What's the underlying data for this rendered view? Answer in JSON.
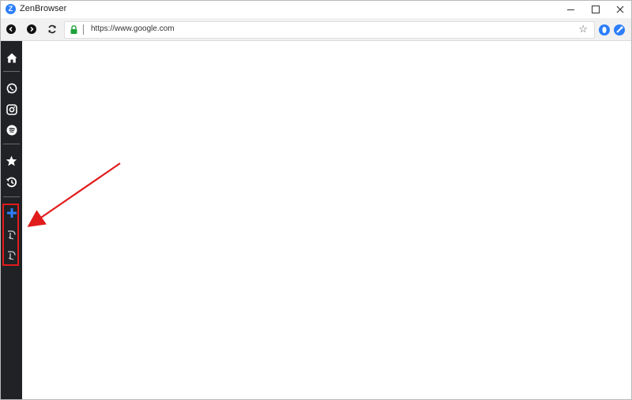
{
  "window": {
    "title": "ZenBrowser",
    "logo_letter": "Z",
    "controls": [
      "minimize-icon",
      "maximize-icon",
      "close-icon"
    ]
  },
  "toolbar": {
    "back_icon": "chevron-left-icon",
    "forward_icon": "chevron-right-icon",
    "reload_icon": "reload-icon",
    "secure_icon": "lock-icon",
    "url": "https://www.google.com",
    "bookmark_icon": "star-outline-icon",
    "extensions": [
      "extension-shield-icon",
      "extension-app-icon"
    ]
  },
  "sidebar": {
    "items": [
      {
        "name": "home",
        "icon": "home-icon"
      },
      {
        "name": "whatsapp",
        "icon": "whatsapp-icon"
      },
      {
        "name": "instagram",
        "icon": "instagram-icon"
      },
      {
        "name": "spotify",
        "icon": "spotify-icon"
      },
      {
        "name": "favorites",
        "icon": "star-icon"
      },
      {
        "name": "history",
        "icon": "history-icon"
      },
      {
        "name": "add",
        "icon": "plus-icon"
      },
      {
        "name": "custom-app-1",
        "icon": "custom-app-icon"
      },
      {
        "name": "custom-app-2",
        "icon": "custom-app-icon"
      }
    ]
  },
  "colors": {
    "sidebar_bg": "#202225",
    "accent_blue": "#2d7ff9",
    "annotation_red": "#e11c1c",
    "secure_green": "#1fa23a"
  }
}
